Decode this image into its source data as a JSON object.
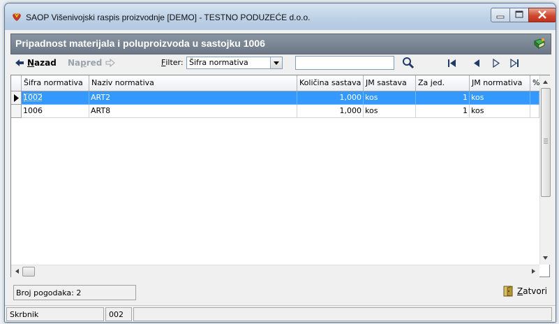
{
  "window": {
    "title": "SAOP  Višenivojski raspis proizvodnje  [DEMO] - TESTNO PODUZEĆE d.o.o."
  },
  "header": {
    "title": "Pripadnost materijala i poluproizvoda u sastojku 1006"
  },
  "toolbar": {
    "back_key": "N",
    "back_rest": "azad",
    "fwd_pre": "Na",
    "fwd_key": "p",
    "fwd_rest": "red",
    "filter_key": "F",
    "filter_rest": "ilter:",
    "filter_value": "Šifra normativa",
    "search_value": ""
  },
  "grid": {
    "columns": [
      "Šifra normativa",
      "Naziv normativa",
      "Količina sastava",
      "JM sastava",
      "Za jed.",
      "JM normativa",
      "%"
    ],
    "rows": [
      [
        "1002",
        "ART2",
        "1,000",
        "kos",
        "1",
        "kos",
        ""
      ],
      [
        "1006",
        "ART8",
        "1,000",
        "kos",
        "1",
        "kos",
        ""
      ]
    ],
    "selected_row": 0
  },
  "footer": {
    "count_label": "Broj pogodaka: 2",
    "close_key": "Z",
    "close_rest": "atvori"
  },
  "status": {
    "user_label": "Skrbnik",
    "user_code": "002"
  }
}
